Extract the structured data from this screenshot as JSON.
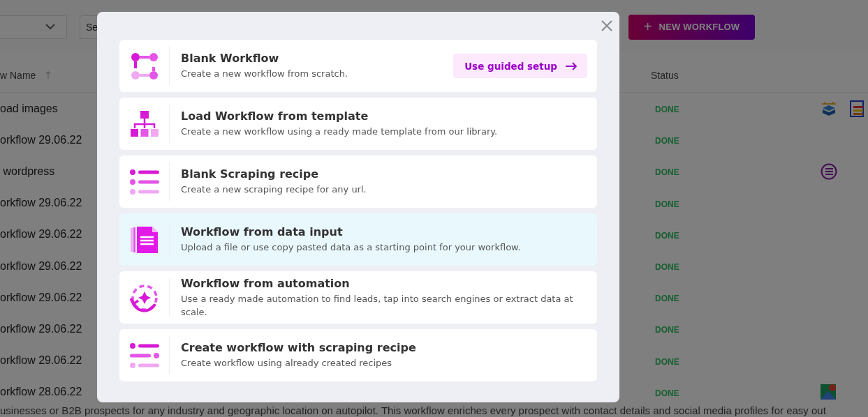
{
  "toolbar": {
    "search": {
      "placeholder": "Se"
    },
    "new_button": {
      "label": "NEW WORKFLOW",
      "icon": "+"
    }
  },
  "table": {
    "columns": [
      {
        "label": "w Name",
        "sorted": true
      },
      {
        "label": "Status"
      }
    ],
    "rows": [
      {
        "name": "oad images",
        "status": "DONE",
        "apps": [
          {
            "kind": "box"
          },
          {
            "kind": "sheet"
          }
        ]
      },
      {
        "name": "orkflow 29.06.22",
        "status": "DONE",
        "apps": []
      },
      {
        "name": " wordpress",
        "status": "DONE",
        "apps": [
          {
            "kind": "list"
          }
        ]
      },
      {
        "name": "orkflow 29.06.22",
        "status": "DONE",
        "apps": []
      },
      {
        "name": "orkflow 29.06.22",
        "status": "DONE",
        "apps": []
      },
      {
        "name": "orkflow 29.06.22",
        "status": "DONE",
        "apps": []
      },
      {
        "name": "orkflow 29.06.22",
        "status": "DONE",
        "apps": []
      },
      {
        "name": "orkflow 29.06.22",
        "status": "DONE",
        "apps": []
      },
      {
        "name": "orkflow 29.06.22",
        "status": "DONE",
        "apps": []
      },
      {
        "name": "orkflow 28.06.22",
        "status": "DONE",
        "apps": [
          {
            "kind": "map"
          }
        ]
      }
    ]
  },
  "footer_text": "usinesses or B2B prospects for any industry and geographic location on autopilot. This workflow enriches every prospect with contact details and social media profiles for easy out",
  "modal": {
    "options": [
      {
        "kind": "blank",
        "title": "Blank Workflow",
        "description": "Create a new workflow from scratch.",
        "selected": false,
        "action": "Use guided setup"
      },
      {
        "kind": "template",
        "title": "Load Workflow from template",
        "description": "Create a new workflow using a ready made template from our library.",
        "selected": false
      },
      {
        "kind": "recipe",
        "title": "Blank Scraping recipe",
        "description": "Create a new scraping recipe for any url.",
        "selected": false
      },
      {
        "kind": "data",
        "title": "Workflow from data input",
        "description": "Upload a file or use copy pasted data as a starting point for your workflow.",
        "selected": true
      },
      {
        "kind": "automation",
        "title": "Workflow from automation",
        "description": "Use a ready made automation to find leads, tap into search engines or extract data at scale.",
        "selected": false
      },
      {
        "kind": "scraping",
        "title": "Create workflow with scraping recipe",
        "description": "Create workflow using already created recipes",
        "selected": false
      }
    ]
  }
}
